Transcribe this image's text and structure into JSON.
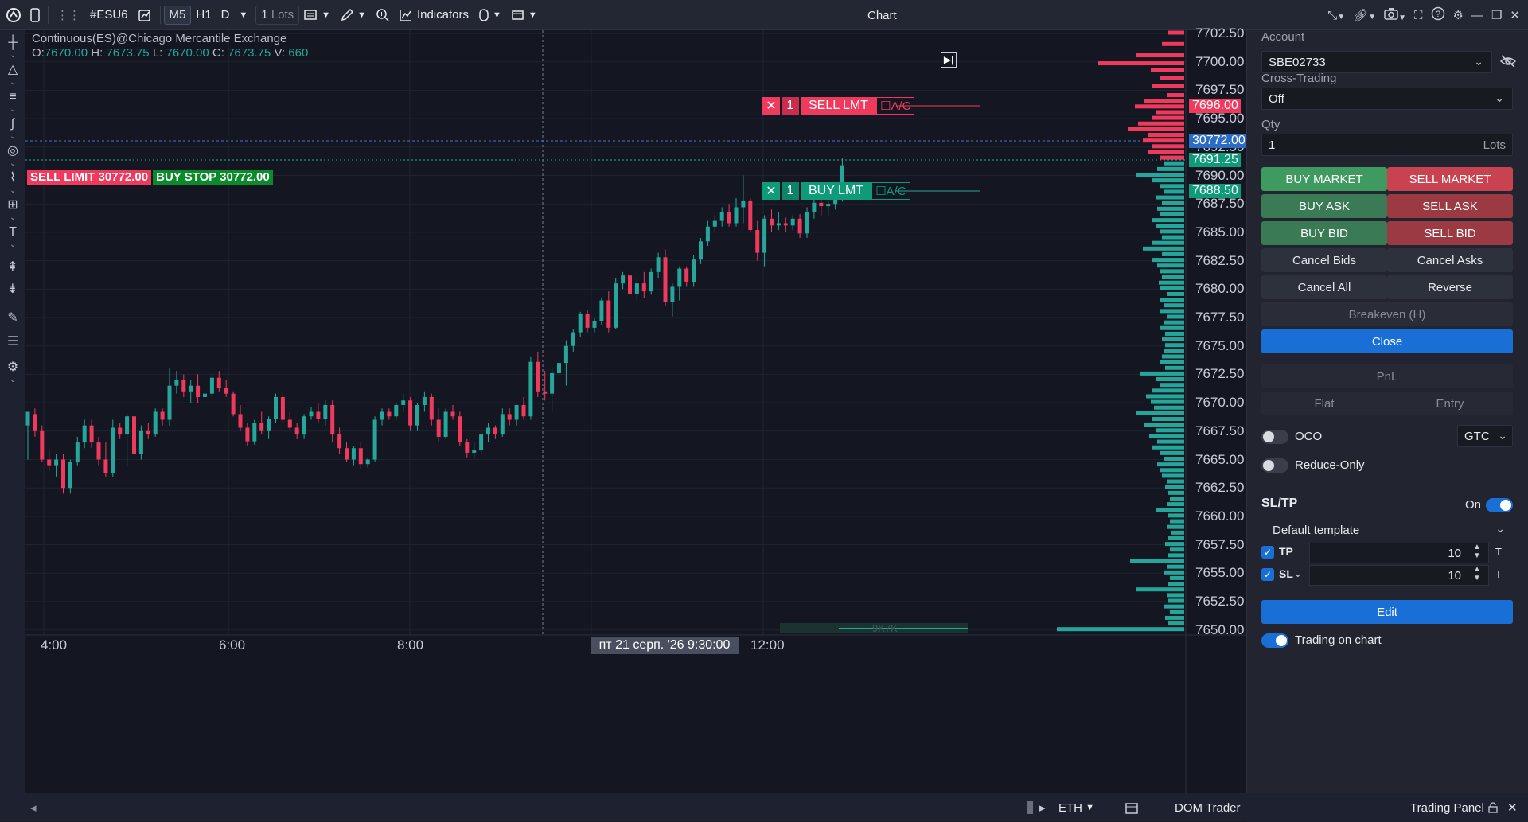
{
  "toolbar": {
    "symbol": "#ESU6",
    "timeframes": [
      "M5",
      "H1",
      "D"
    ],
    "active_timeframe": "M5",
    "qty_value": "1",
    "qty_unit": "Lots",
    "indicators_label": "Indicators",
    "window_title": "Chart"
  },
  "chart": {
    "legend_title": "Continuous(ES)@Chicago Mercantile Exchange",
    "ohlcv": {
      "o_label": "O:",
      "o": "7670.00",
      "h_label": "H:",
      "h": "7673.75",
      "l_label": "L:",
      "l": "7670.00",
      "c_label": "C:",
      "c": "7673.75",
      "v_label": "V:",
      "v": "660"
    },
    "price_levels": [
      "7702.50",
      "7700.00",
      "7697.50",
      "7695.00",
      "7692.50",
      "7690.00",
      "7687.50",
      "7685.00",
      "7682.50",
      "7680.00",
      "7677.50",
      "7675.00",
      "7672.50",
      "7670.00",
      "7667.50",
      "7665.00",
      "7662.50",
      "7660.00",
      "7657.50",
      "7655.00",
      "7652.50",
      "7650.00"
    ],
    "time_labels": [
      "4:00",
      "6:00",
      "8:00",
      "12:00"
    ],
    "crosshair_time": "пт 21 серп. '26 9:30:00",
    "tags": {
      "sell_lmt_price": "7696.00",
      "position_price": "30772.00",
      "last_price": "7691.25",
      "buy_lmt_price": "7688.50"
    },
    "sell_order": {
      "qty": "1",
      "label": "SELL LMT",
      "ac": "A/C"
    },
    "buy_order": {
      "qty": "1",
      "label": "BUY LMT",
      "ac": "A/C"
    },
    "position_labels": {
      "sell_limit": "SELL LIMIT 30772.00",
      "buy_stop": "BUY STOP 30772.00"
    },
    "volume_label": "9K7K",
    "colors": {
      "up": "#26a69a",
      "down": "#ef3a5d",
      "bg": "#141722"
    }
  },
  "bottom": {
    "session": "ETH",
    "dom_trader": "DOM Trader",
    "trading_panel": "Trading Panel"
  },
  "panel": {
    "account_label": "Account",
    "account_value": "SBE02733",
    "cross_label": "Cross-Trading",
    "cross_value": "Off",
    "qty_label": "Qty",
    "qty_value": "1",
    "qty_unit": "Lots",
    "buy_market": "BUY MARKET",
    "sell_market": "SELL MARKET",
    "buy_ask": "BUY ASK",
    "sell_ask": "SELL ASK",
    "buy_bid": "BUY BID",
    "sell_bid": "SELL BID",
    "cancel_bids": "Cancel Bids",
    "cancel_asks": "Cancel Asks",
    "cancel_all": "Cancel All",
    "reverse": "Reverse",
    "breakeven": "Breakeven (H)",
    "close": "Close",
    "pnl": "PnL",
    "flat": "Flat",
    "entry": "Entry",
    "oco": "OCO",
    "gtc": "GTC",
    "reduce_only": "Reduce-Only",
    "sltp": "SL/TP",
    "sltp_state": "On",
    "template": "Default template",
    "tp_label": "TP",
    "tp_value": "10",
    "sl_label": "SL",
    "sl_value": "10",
    "t_label": "T",
    "edit": "Edit",
    "trading_on_chart": "Trading on chart"
  }
}
